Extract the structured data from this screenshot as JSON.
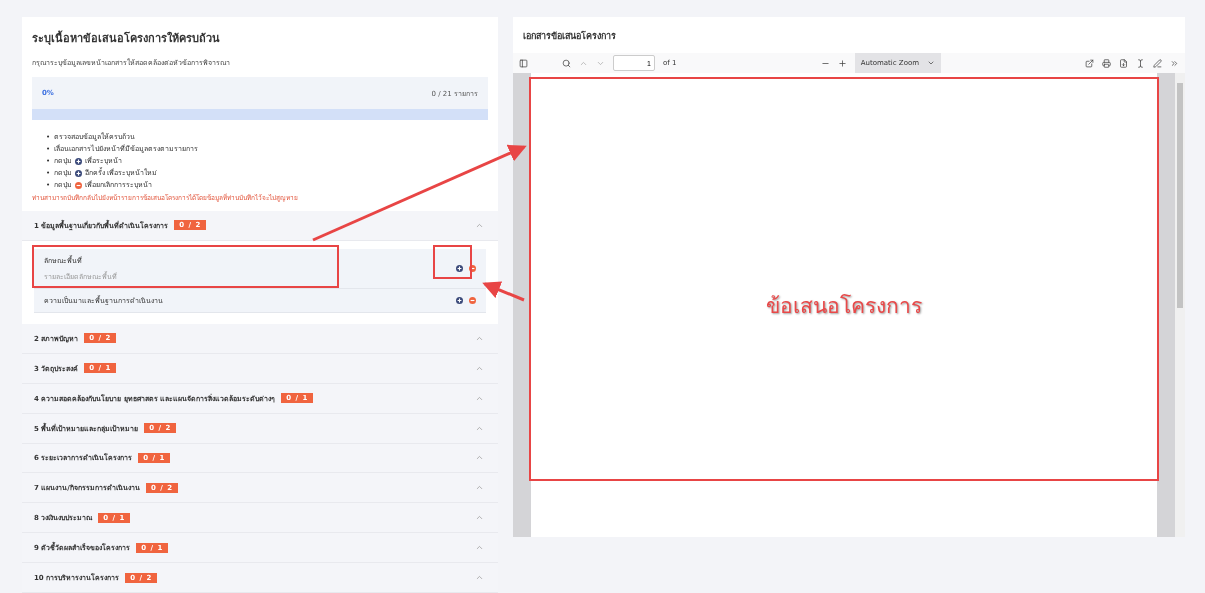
{
  "form_panel": {
    "title": "ระบุเนื้อหาข้อเสนอโครงการให้ครบถ้วน",
    "subtitle": "กรุณาระบุข้อมูลเลขหน้าเอกสารให้สอดคล้องต่อหัวข้อการพิจารณา",
    "progress": {
      "percent": "0%",
      "count": "0 / 21 รายการ",
      "level": 0
    },
    "instructions": [
      {
        "bullet": "•",
        "kind": "text",
        "before": "ตรวจสอบข้อมูลให้ครบถ้วน"
      },
      {
        "bullet": "•",
        "kind": "text",
        "before": "เลื่อนเอกสารไปยังหน้าที่มีข้อมูลตรงตามรายการ"
      },
      {
        "bullet": "•",
        "kind": "plus",
        "before": "กดปุ่ม",
        "after": "เพื่อระบุหน้า"
      },
      {
        "bullet": "•",
        "kind": "plus",
        "before": "กดปุ่ม",
        "after": "อีกครั้ง เพื่อระบุหน้าใหม่"
      },
      {
        "bullet": "•",
        "kind": "minus",
        "before": "กดปุ่ม",
        "after": "เพื่อยกเลิกการระบุหน้า"
      }
    ],
    "note": "ท่านสามารถบันทึกกลับไปยังหน้ารายการข้อเสนอโครงการได้โดยข้อมูลที่ท่านบันทึกไว้จะไม่สูญหาย"
  },
  "sections": [
    {
      "title": "1 ข้อมูลพื้นฐานเกี่ยวกับพื้นที่ดำเนินโครงการ",
      "badge": "0 / 2",
      "expanded": true,
      "items": [
        {
          "title": "ลักษณะพื้นที่",
          "description": "รายละเอียดลักษณะพื้นที่"
        },
        {
          "title": "ความเป็นมาและพื้นฐานการดำเนินงาน"
        }
      ]
    },
    {
      "title": "2 สภาพปัญหา",
      "badge": "0 / 2",
      "expanded": false
    },
    {
      "title": "3 วัตถุประสงค์",
      "badge": "0 / 1",
      "expanded": false
    },
    {
      "title": "4 ความสอดคล้องกับนโยบาย ยุทธศาสตร และแผนจัดการสิ่งแวดล้อมระดับต่างๆ",
      "badge": "0 / 1",
      "expanded": false
    },
    {
      "title": "5 พื้นที่เป้าหมายและกลุ่มเป้าหมาย",
      "badge": "0 / 2",
      "expanded": false
    },
    {
      "title": "6 ระยะเวลาการดำเนินโครงการ",
      "badge": "0 / 1",
      "expanded": false
    },
    {
      "title": "7 แผนงาน/กิจกรรมการดำเนินงาน",
      "badge": "0 / 2",
      "expanded": false
    },
    {
      "title": "8 วงเงินงบประมาณ",
      "badge": "0 / 1",
      "expanded": false
    },
    {
      "title": "9 ตัวชี้วัดผลสำเร็จของโครงการ",
      "badge": "0 / 1",
      "expanded": false
    },
    {
      "title": "10 การบริหารงานโครงการ",
      "badge": "0 / 2",
      "expanded": false
    }
  ],
  "document_panel": {
    "title": "เอกสารข้อเสนอโครงการ",
    "page_number": "1",
    "page_total": "of 1",
    "zoom": "Automatic Zoom",
    "page_text": "ข้อเสนอโครงการ"
  }
}
